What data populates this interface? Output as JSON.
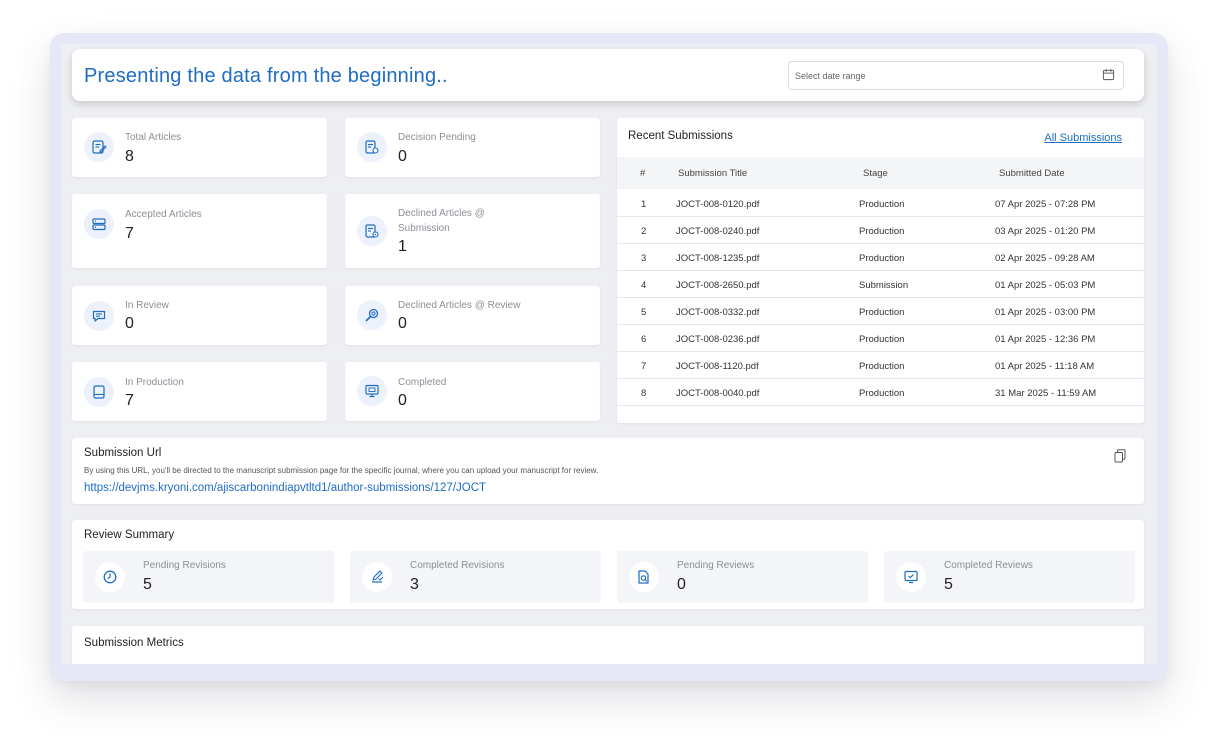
{
  "header": {
    "title": "Presenting the data from the beginning..",
    "date_placeholder": "Select date range"
  },
  "stats": {
    "total_articles": {
      "label": "Total Articles",
      "value": "8"
    },
    "decision_pending": {
      "label": "Decision Pending",
      "value": "0"
    },
    "accepted_articles": {
      "label": "Accepted Articles",
      "value": "7"
    },
    "declined_submission": {
      "label": "Declined Articles @ Submission",
      "value": "1"
    },
    "in_review": {
      "label": "In Review",
      "value": "0"
    },
    "declined_review": {
      "label": "Declined Articles @ Review",
      "value": "0"
    },
    "in_production": {
      "label": "In Production",
      "value": "7"
    },
    "completed": {
      "label": "Completed",
      "value": "0"
    }
  },
  "recent": {
    "title": "Recent Submissions",
    "all_link": "All Submissions",
    "columns": [
      "#",
      "Submission Title",
      "Stage",
      "Submitted Date"
    ],
    "rows": [
      [
        "1",
        "JOCT-008-0120.pdf",
        "Production",
        "07 Apr 2025 - 07:28 PM"
      ],
      [
        "2",
        "JOCT-008-0240.pdf",
        "Production",
        "03 Apr 2025 - 01:20 PM"
      ],
      [
        "3",
        "JOCT-008-1235.pdf",
        "Production",
        "02 Apr 2025 - 09:28 AM"
      ],
      [
        "4",
        "JOCT-008-2650.pdf",
        "Submission",
        "01 Apr 2025 - 05:03 PM"
      ],
      [
        "5",
        "JOCT-008-0332.pdf",
        "Production",
        "01 Apr 2025 - 03:00 PM"
      ],
      [
        "6",
        "JOCT-008-0236.pdf",
        "Production",
        "01 Apr 2025 - 12:36 PM"
      ],
      [
        "7",
        "JOCT-008-1120.pdf",
        "Production",
        "01 Apr 2025 - 11:18 AM"
      ],
      [
        "8",
        "JOCT-008-0040.pdf",
        "Production",
        "31 Mar 2025 - 11:59 AM"
      ]
    ]
  },
  "submission_url": {
    "title": "Submission Url",
    "description": "By using this URL, you'll be directed to the manuscript submission page for the specific journal, where you can upload your manuscript for review.",
    "url": "https://devjms.kryoni.com/ajiscarbonindiapvtltd1/author-submissions/127/JOCT"
  },
  "review_summary": {
    "title": "Review Summary",
    "items": [
      {
        "label": "Pending Revisions",
        "value": "5",
        "icon": "clock-icon"
      },
      {
        "label": "Completed Revisions",
        "value": "3",
        "icon": "edit-check-icon"
      },
      {
        "label": "Pending Reviews",
        "value": "0",
        "icon": "document-search-icon"
      },
      {
        "label": "Completed Reviews",
        "value": "5",
        "icon": "monitor-check-icon"
      }
    ]
  },
  "metrics": {
    "title": "Submission Metrics"
  },
  "colors": {
    "accent": "#1f6cc5",
    "icon_bg": "#edf1fb",
    "page_bg": "#eeeff2"
  }
}
